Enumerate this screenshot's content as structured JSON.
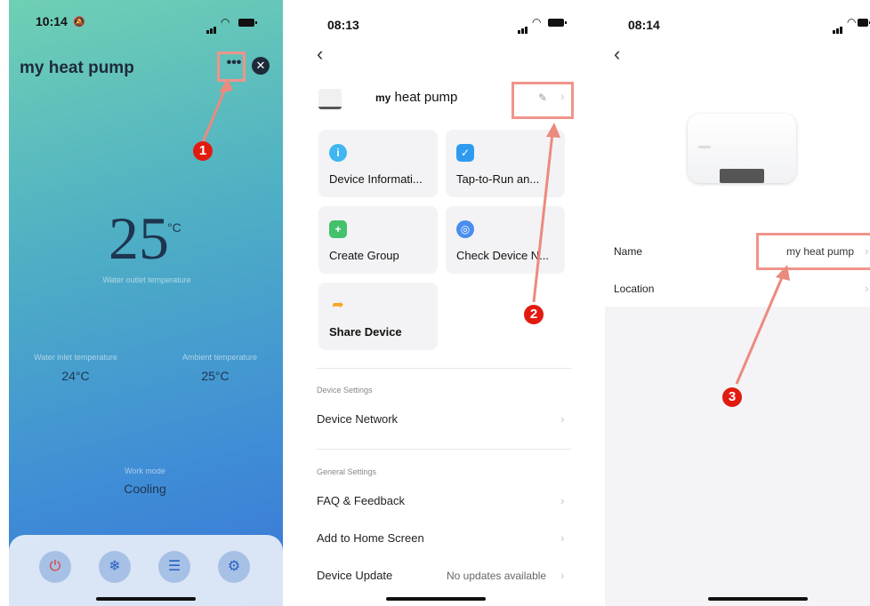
{
  "screen1": {
    "status_time": "10:14",
    "title": "my heat pump",
    "more_glyph": "•••",
    "close_glyph": "✕",
    "temp_value": "25",
    "temp_unit": "°C",
    "outlet_label": "Water outlet temperature",
    "inlet_label": "Water inlet temperature",
    "inlet_value": "24°C",
    "ambient_label": "Ambient temperature",
    "ambient_value": "25°C",
    "mode_label": "Work mode",
    "mode_value": "Cooling",
    "controls": [
      {
        "icon": "power-icon",
        "glyph": "⏻"
      },
      {
        "icon": "snowflake-icon",
        "glyph": "❄"
      },
      {
        "icon": "document-icon",
        "glyph": "☰"
      },
      {
        "icon": "gear-icon",
        "glyph": "⚙"
      }
    ],
    "power_color": "#e0342b",
    "icon_color": "#2b5fc2"
  },
  "screen2": {
    "status_time": "08:13",
    "back_glyph": "‹",
    "device_name_bold": "my",
    "device_name_rest": "heat pump",
    "cards": [
      {
        "label": "Device Informati...",
        "icon": "info-icon",
        "color": "#3fb6f0",
        "glyph": "i"
      },
      {
        "label": "Tap-to-Run an...",
        "icon": "check-badge-icon",
        "color": "#2f9bf0",
        "glyph": "✓"
      },
      {
        "label": "Create Group",
        "icon": "group-add-icon",
        "color": "#43c16b",
        "glyph": "+"
      },
      {
        "label": "Check Device N...",
        "icon": "network-check-icon",
        "color": "#4a8df0",
        "glyph": "◎"
      },
      {
        "label": "Share Device",
        "icon": "share-icon",
        "color": "#f5a623",
        "glyph": "➦"
      }
    ],
    "device_settings_header": "Device Settings",
    "device_network": "Device Network",
    "general_settings_header": "General Settings",
    "faq": "FAQ & Feedback",
    "add_home": "Add to Home Screen",
    "device_update": "Device Update",
    "update_status": "No updates available",
    "chevron": "›"
  },
  "screen3": {
    "status_time": "08:14",
    "back_glyph": "‹",
    "name_label": "Name",
    "name_value": "my heat pump",
    "location_label": "Location",
    "chevron": "›"
  },
  "annotations": {
    "markers": [
      "1",
      "2",
      "3"
    ],
    "box_color": "#f0948a",
    "marker_color": "#e21b10"
  }
}
